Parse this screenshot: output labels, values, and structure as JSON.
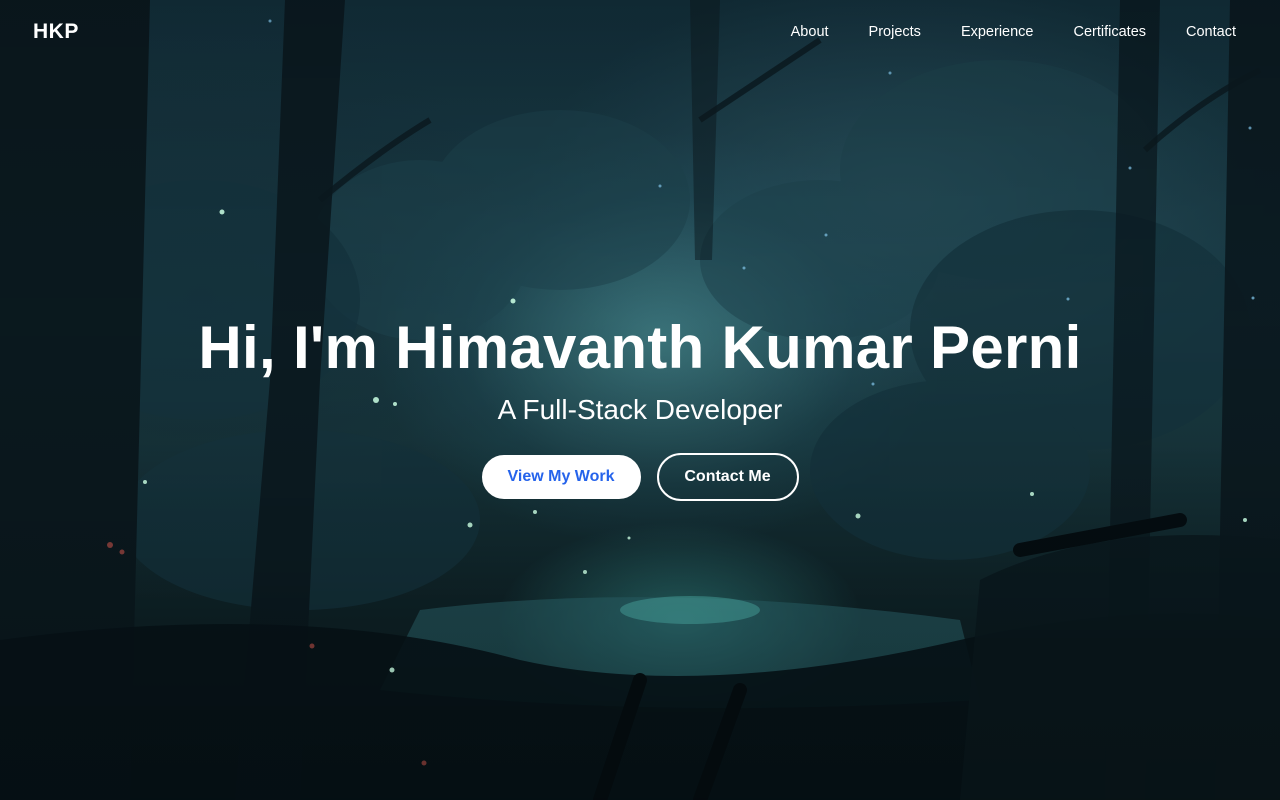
{
  "header": {
    "logo": "HKP",
    "nav": [
      {
        "label": "About"
      },
      {
        "label": "Projects"
      },
      {
        "label": "Experience"
      },
      {
        "label": "Certificates"
      },
      {
        "label": "Contact"
      }
    ]
  },
  "hero": {
    "title": "Hi, I'm Himavanth Kumar Perni",
    "subtitle": "A Full-Stack Developer",
    "primary_button": "View My Work",
    "secondary_button": "Contact Me"
  },
  "colors": {
    "primary_button_text": "#2563eb",
    "text": "#ffffff"
  }
}
